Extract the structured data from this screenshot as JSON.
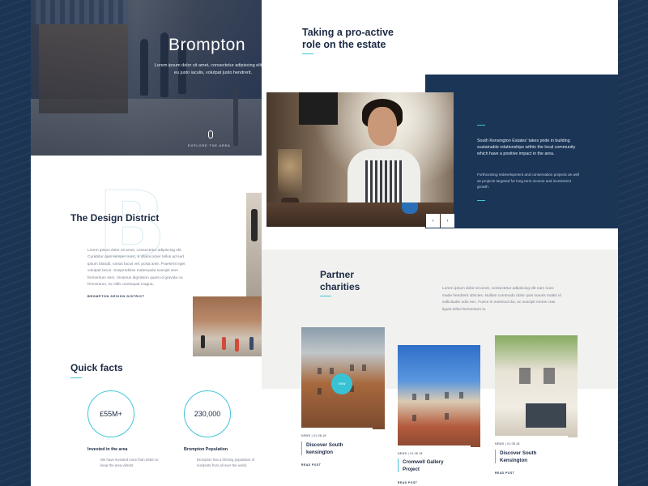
{
  "colors": {
    "navy": "#1b3557",
    "accent": "#43c6d6",
    "text_dark": "#1c2a44",
    "text_muted": "#7a8190"
  },
  "hero": {
    "title": "Brompton",
    "subtitle": "Lorem ipsum dolor sit amet, consectetur adipiscing elit cras eu justo iaculis, volutpat justo hendrerit.",
    "explore_label": "EXPLORE THE AREA",
    "explore_icon": "mouse-scroll-icon"
  },
  "design": {
    "letter": "B",
    "title": "The Design District",
    "body": "Lorem ipsum dolor sit amet, consectetur adipiscing elit. Curabitur quis semper nunc, a ullamcorper tellus ad sed ipsum blandit, varius lacus vel, porta ante. Praesent eget volutpat lacus. Suspendisse malesuada suscipit sem fermentum sem. Vivamus dignissim quam id gravida ca fermentum, ex nibh consequat magna.",
    "link": "BROMPTON DESIGN DISTRICT"
  },
  "facts": {
    "title": "Quick facts",
    "items": [
      {
        "value": "£55M+",
        "label": "Invested in the area",
        "text": "We have invested more than £55m to keep the area vibrant."
      },
      {
        "value": "230,000",
        "label": "Brompton Population",
        "text": "Brompton has a thriving population of residents from all over the world."
      }
    ]
  },
  "estate": {
    "title_line1": "Taking a pro-active",
    "title_line2": "role on the estate",
    "para1": "South Kensington Estates' takes pride in building sustainable relationships within the local community which have a positive impact in the area.",
    "para2": "Forthcoming redevelopment and conservation projects as well as projects targeted for long term income and investment growth.",
    "prev_label": "‹",
    "next_label": "›"
  },
  "partners": {
    "title_line1": "Partner",
    "title_line2": "charities",
    "text": "Lorem ipsum dolor sit amet, consectetur adipiscing elit nam nunc made hendrerit ultricies. Nullam commodo dolor quis mauris mattis id sollicitudin odio nec. Fusce in euismod dui, ac suscipit metus cras ligula tellus fermentum in.",
    "view_label": "VIEW",
    "cards": [
      {
        "meta": "NEWS  |  01.08.18",
        "title": "Discover South kensington",
        "read": "READ POST"
      },
      {
        "meta": "NEWS  |  01.08.18",
        "title": "Cromwell Gallery Project",
        "read": "READ POST"
      },
      {
        "meta": "NEWS  |  01.08.18",
        "title": "Discover South Kensington",
        "read": "READ POST"
      }
    ]
  }
}
